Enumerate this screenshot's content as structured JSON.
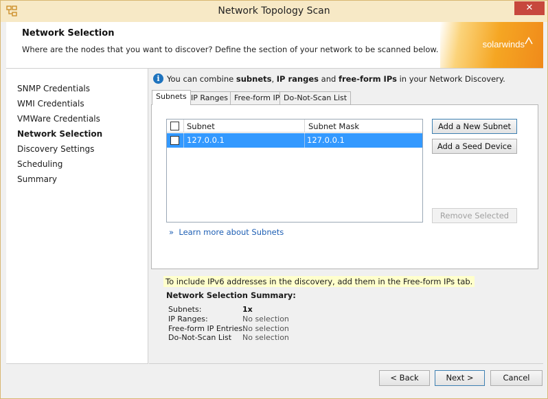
{
  "window": {
    "title": "Network Topology Scan",
    "close_symbol": "✕"
  },
  "header": {
    "title": "Network Selection",
    "subtitle": "Where are the nodes that you want to discover? Define the section of your network to be scanned below.",
    "brand": "solarwinds"
  },
  "sidebar": {
    "items": [
      {
        "label": "SNMP Credentials",
        "active": false
      },
      {
        "label": "WMI Credentials",
        "active": false
      },
      {
        "label": "VMWare Credentials",
        "active": false
      },
      {
        "label": "Network Selection",
        "active": true
      },
      {
        "label": "Discovery Settings",
        "active": false
      },
      {
        "label": "Scheduling",
        "active": false
      },
      {
        "label": "Summary",
        "active": false
      }
    ]
  },
  "info": {
    "icon": "i",
    "prefix": "You can combine ",
    "term1": "subnets",
    "sep1": ", ",
    "term2": "IP ranges",
    "sep2": " and ",
    "term3": "free-form IPs",
    "suffix": " in your Network Discovery."
  },
  "tabs": [
    {
      "label": "Subnets",
      "active": true
    },
    {
      "label": "IP Ranges",
      "active": false
    },
    {
      "label": "Free-form IPs",
      "active": false
    },
    {
      "label": "Do-Not-Scan List",
      "active": false
    }
  ],
  "grid": {
    "columns": [
      "Subnet",
      "Subnet Mask"
    ],
    "rows": [
      {
        "subnet": "127.0.0.1",
        "mask": "127.0.0.1",
        "selected": true
      }
    ]
  },
  "buttons": {
    "add_subnet": "Add a New Subnet",
    "add_seed": "Add a Seed Device",
    "remove_selected": "Remove Selected"
  },
  "learn_link": {
    "arrow": "»",
    "text": "Learn more about Subnets"
  },
  "ipv6_note": "To include IPv6 addresses in the discovery, add them in the Free-form IPs tab.",
  "summary": {
    "title": "Network Selection Summary:",
    "rows": [
      {
        "label": "Subnets:",
        "value": "1x"
      },
      {
        "label": "IP Ranges:",
        "value": "No selection"
      },
      {
        "label": "Free-form IP Entries:",
        "value": "No selection"
      },
      {
        "label": "Do-Not-Scan List",
        "value": "No selection"
      }
    ]
  },
  "footer": {
    "back": "< Back",
    "next": "Next >",
    "cancel": "Cancel"
  },
  "colors": {
    "title_bar": "#f7e9c6",
    "selection": "#3399ff",
    "close_button": "#c7483d",
    "brand_orange": "#f5a623",
    "link": "#1e5fb4",
    "note_highlight": "#ffffcc"
  }
}
